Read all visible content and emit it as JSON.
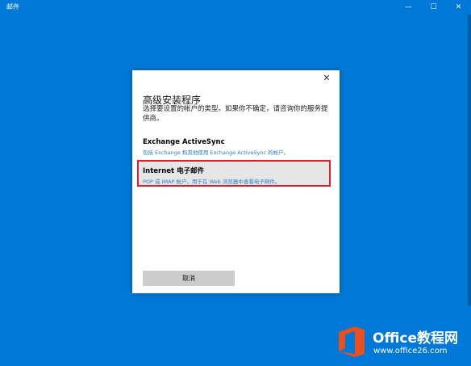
{
  "window": {
    "title": "邮件",
    "minimize_glyph": "—",
    "maximize_glyph": "☐",
    "close_glyph": "✕"
  },
  "dialog": {
    "close_glyph": "✕",
    "heading": "高级安装程序",
    "description": "选择要设置的帐户的类型。如果你不确定，请咨询你的服务提供商。",
    "options": [
      {
        "title": "Exchange ActiveSync",
        "subtitle": "包括 Exchange 和其他使用 Exchange ActiveSync 的帐户。"
      },
      {
        "title": "Internet 电子邮件",
        "subtitle": "POP 或 IMAP 帐户，用于在 Web 浏览器中查看电子邮件。"
      }
    ],
    "cancel_label": "取消"
  },
  "watermark": {
    "brand": "Office教程网",
    "url": "www.office26.com"
  },
  "colors": {
    "background": "#0078d7",
    "highlight_border": "#d9202a",
    "subtitle": "#2a7ec9",
    "watermark_logo": "#e8501e"
  }
}
